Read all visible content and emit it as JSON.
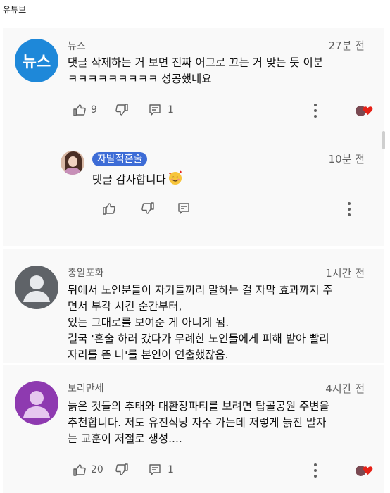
{
  "topbar": {
    "label": "유튜브"
  },
  "comments": [
    {
      "author": "뉴스",
      "avatar_text": "뉴스",
      "time": "27분 전",
      "lines": [
        "댓글 삭제하는 거 보면 진짜 어그로 끄는 거 맞는 듯 이분",
        "ㅋㅋㅋㅋㅋㅋㅋㅋㅋ 성공했네요"
      ],
      "likes": "9",
      "replies": "1"
    },
    {
      "author_badge": "자발적혼술",
      "time": "10분 전",
      "lines": [
        "댓글 감사합니다"
      ]
    },
    {
      "author": "총알포화",
      "time": "1시간 전",
      "lines": [
        "뒤에서 노인분들이 자기들끼리 말하는 걸 자막 효과까지 주",
        "면서 부각 시킨 순간부터,",
        "있는 그대로를 보여준 게 아니게 됨.",
        "결국 '혼술 하러 갔다가 무례한 노인들에게 피해 받아 빨리",
        "자리를 뜬 나'를 본인이 연출했잖음."
      ]
    },
    {
      "author": "보리만세",
      "time": "4시간 전",
      "lines": [
        "늙은 것들의 추태와 대환장파티를 보려면 탑골공원 주변을",
        "추천합니다. 저도 유진식당 자주 가는데 저렇게 늙진 말자",
        "는 교훈이 저절로 생성...."
      ],
      "likes": "20",
      "replies": "1"
    }
  ],
  "colors": {
    "panel": "#f9f9f9",
    "text": "#111111",
    "secondary": "#606060",
    "badge": "#3d6cd6",
    "news_avatar": "#1e88d9",
    "purple_avatar": "#8e3ab0"
  },
  "icons": [
    "thumb-up-icon",
    "thumb-down-icon",
    "reply-icon",
    "more-vert-icon",
    "creator-heart-icon"
  ]
}
